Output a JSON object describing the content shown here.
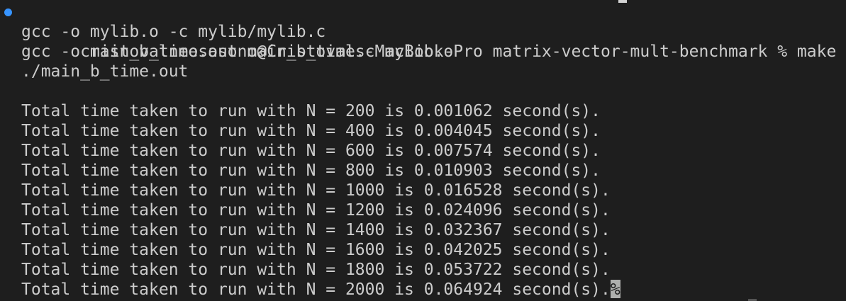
{
  "terminal": {
    "prompt_status_color": "#3794ff",
    "prompt_line": "cristovalneosasono@Cristovals-MacBook-Pro matrix-vector-mult-benchmark % make time",
    "build_lines": [
      "gcc -o mylib.o -c mylib/mylib.c",
      "gcc -o main_b_time.out main_b_time.c mylib.o",
      "./main_b_time.out"
    ],
    "output_lines": [
      "Total time taken to run with N = 200 is 0.001062 second(s).",
      "Total time taken to run with N = 400 is 0.004045 second(s).",
      "Total time taken to run with N = 600 is 0.007574 second(s).",
      "Total time taken to run with N = 800 is 0.010903 second(s).",
      "Total time taken to run with N = 1000 is 0.016528 second(s).",
      "Total time taken to run with N = 1200 is 0.024096 second(s).",
      "Total time taken to run with N = 1400 is 0.032367 second(s).",
      "Total time taken to run with N = 1600 is 0.042025 second(s).",
      "Total time taken to run with N = 1800 is 0.053722 second(s)."
    ],
    "last_output_line": "Total time taken to run with N = 2000 is 0.064924 second(s).",
    "cursor_glyph": "%"
  }
}
